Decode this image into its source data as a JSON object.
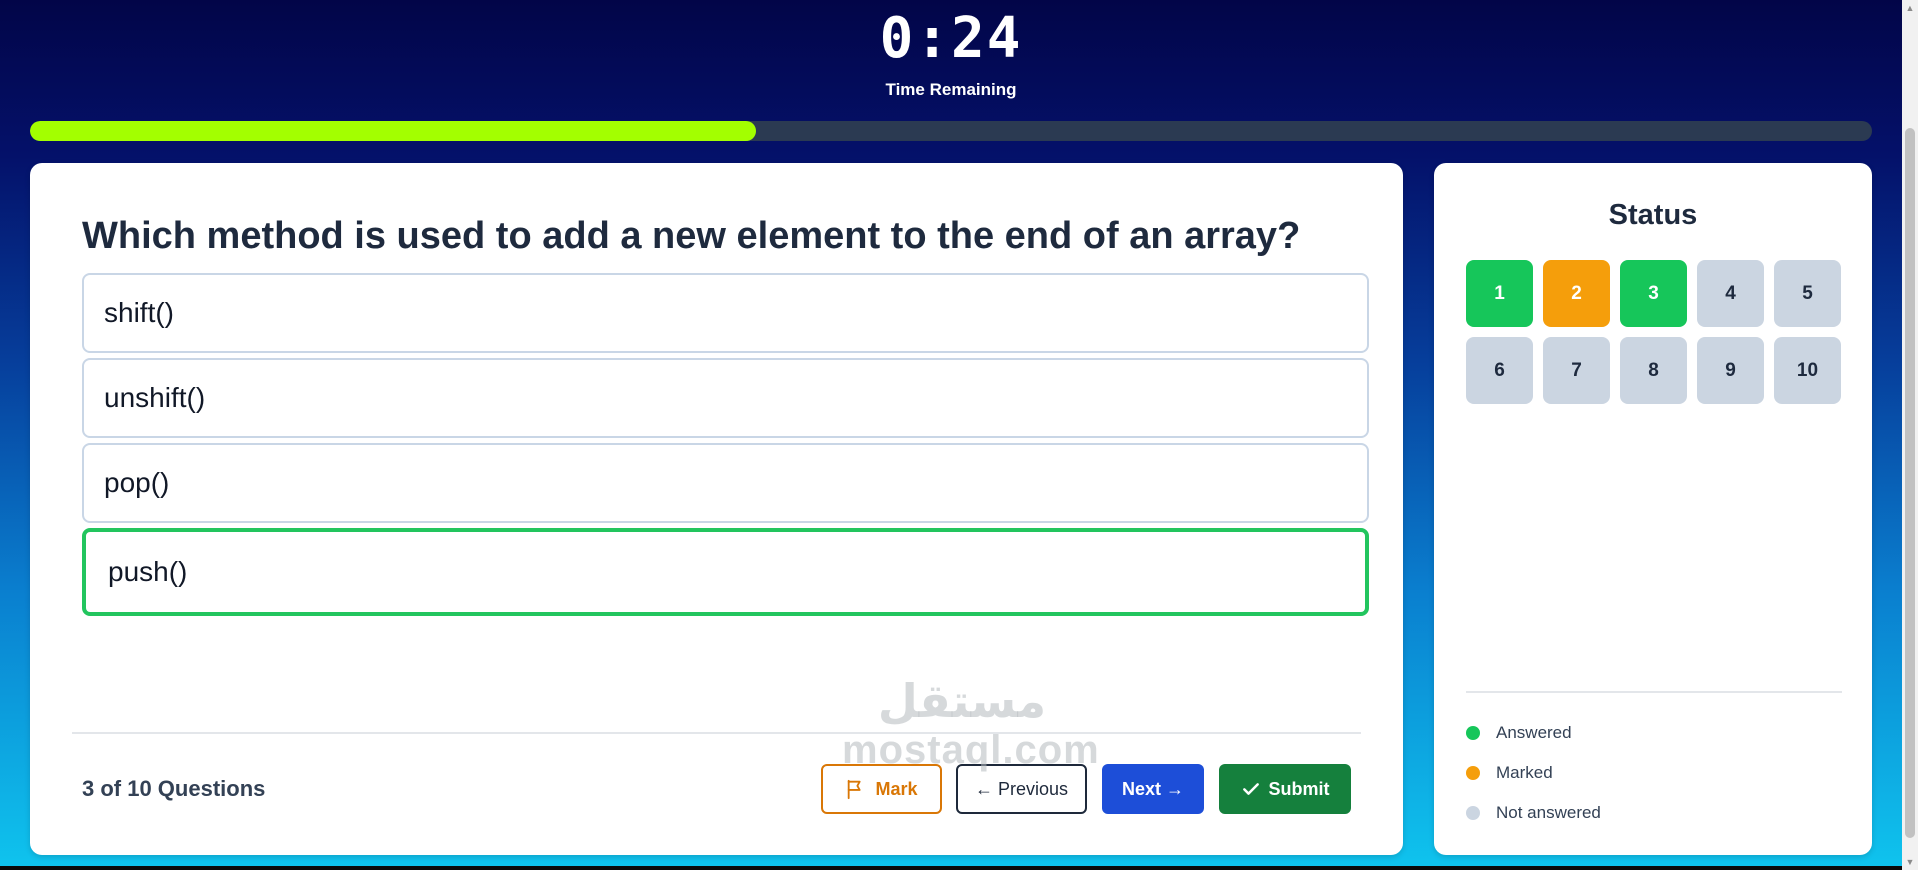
{
  "timer": {
    "value": "0:24",
    "label": "Time Remaining"
  },
  "progress": {
    "fraction": 0.394,
    "color": "#a3ff00"
  },
  "question": {
    "text": "Which method is used to add a new element to the end of an array?",
    "options": [
      {
        "label": "shift()",
        "selected": false
      },
      {
        "label": "unshift()",
        "selected": false
      },
      {
        "label": "pop()",
        "selected": false
      },
      {
        "label": "push()",
        "selected": true
      }
    ],
    "counter": "3 of 10 Questions"
  },
  "buttons": {
    "mark": "Mark",
    "previous": "← Previous",
    "next": "Next →",
    "submit": "Submit"
  },
  "status": {
    "title": "Status",
    "questions": [
      {
        "number": "1",
        "state": "answered"
      },
      {
        "number": "2",
        "state": "marked"
      },
      {
        "number": "3",
        "state": "answered"
      },
      {
        "number": "4",
        "state": "not-answered"
      },
      {
        "number": "5",
        "state": "not-answered"
      },
      {
        "number": "6",
        "state": "not-answered"
      },
      {
        "number": "7",
        "state": "not-answered"
      },
      {
        "number": "8",
        "state": "not-answered"
      },
      {
        "number": "9",
        "state": "not-answered"
      },
      {
        "number": "10",
        "state": "not-answered"
      }
    ],
    "legend": [
      {
        "label": "Answered",
        "color": "#16c65a"
      },
      {
        "label": "Marked",
        "color": "#f59e0b"
      },
      {
        "label": "Not answered",
        "color": "#cbd5e1"
      }
    ]
  },
  "watermark": {
    "arabic": "مستقل",
    "latin": "mostaql.com"
  },
  "colors": {
    "selected_border": "#22c55e",
    "next_button": "#1d4ed8",
    "submit_button": "#15803d",
    "mark_button": "#d97706"
  }
}
